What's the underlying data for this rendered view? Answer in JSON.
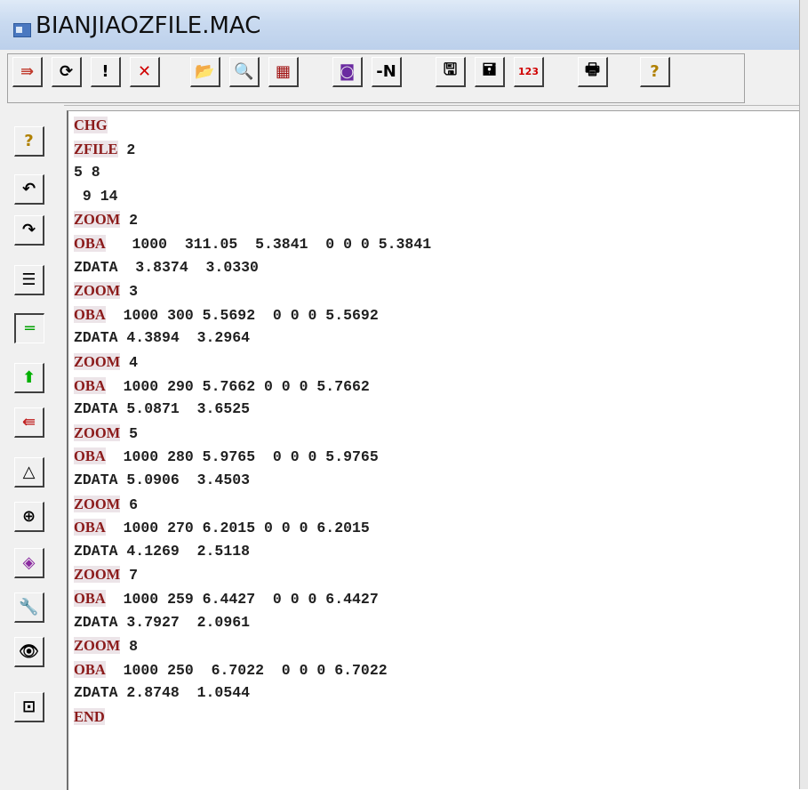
{
  "window": {
    "title": "BIANJIAOZFILE.MAC"
  },
  "toolbar": {
    "buttons": [
      {
        "name": "import-icon-button",
        "glyph": "⇛",
        "color": "#c0392b"
      },
      {
        "name": "refresh-button",
        "glyph": "⟳",
        "color": "#000000"
      },
      {
        "name": "exclaim-button",
        "glyph": "!",
        "color": "#000000"
      },
      {
        "name": "delete-button",
        "glyph": "✕",
        "color": "#d00000"
      },
      {
        "name": "open-folder-button",
        "glyph": "📂",
        "color": "#c88a00"
      },
      {
        "name": "search-button",
        "glyph": "🔍",
        "color": "#000000"
      },
      {
        "name": "macro-button",
        "glyph": "▦",
        "color": "#a01010"
      },
      {
        "name": "edit-card-button",
        "glyph": "◙",
        "color": "#6a2aa0"
      },
      {
        "name": "minus-n-button",
        "glyph": "-N",
        "color": "#000000"
      },
      {
        "name": "save-button",
        "glyph": "🖫",
        "color": "#000000"
      },
      {
        "name": "save-as-button",
        "glyph": "🖬",
        "color": "#000000"
      },
      {
        "name": "number-button",
        "glyph": "123",
        "color": "#d00000"
      },
      {
        "name": "print-button",
        "glyph": "🖶",
        "color": "#000000"
      },
      {
        "name": "help-button",
        "glyph": "?",
        "color": "#b08000"
      }
    ]
  },
  "sidebar": {
    "buttons": [
      {
        "name": "help-icon-button",
        "glyph": "?",
        "color": "#b08000"
      },
      {
        "name": "undo-button",
        "glyph": "↶",
        "color": "#000000"
      },
      {
        "name": "redo-button",
        "glyph": "↷",
        "color": "#000000"
      },
      {
        "name": "indent-button",
        "glyph": "☰",
        "color": "#000000"
      },
      {
        "name": "equal-button",
        "glyph": "═",
        "color": "#00a000"
      },
      {
        "name": "up-arrow-button",
        "glyph": "⬆",
        "color": "#00b000"
      },
      {
        "name": "left-arrow-button",
        "glyph": "⇚",
        "color": "#c02020"
      },
      {
        "name": "triangle-button",
        "glyph": "△",
        "color": "#000000"
      },
      {
        "name": "target-button",
        "glyph": "⊕",
        "color": "#000000"
      },
      {
        "name": "cube-button",
        "glyph": "◈",
        "color": "#8a2aa0"
      },
      {
        "name": "wrench-button",
        "glyph": "🔧",
        "color": "#606060"
      },
      {
        "name": "eye-button",
        "glyph": "👁",
        "color": "#000000"
      },
      {
        "name": "exit-button",
        "glyph": "⊡",
        "color": "#000000"
      }
    ]
  },
  "editor": {
    "lines": [
      {
        "kw": "CHG",
        "rest": ""
      },
      {
        "kw": "ZFILE",
        "rest": " 2"
      },
      {
        "kw": "",
        "rest": "5 8"
      },
      {
        "kw": "",
        "rest": " 9 14"
      },
      {
        "kw": "ZOOM",
        "rest": " 2"
      },
      {
        "kw": "OBA",
        "rest": "   1000  311.05  5.3841  0 0 0 5.3841"
      },
      {
        "kw": "",
        "rest": "ZDATA  3.8374  3.0330"
      },
      {
        "kw": "ZOOM",
        "rest": " 3"
      },
      {
        "kw": "OBA",
        "rest": "  1000 300 5.5692  0 0 0 5.5692"
      },
      {
        "kw": "",
        "rest": "ZDATA 4.3894  3.2964"
      },
      {
        "kw": "ZOOM",
        "rest": " 4"
      },
      {
        "kw": "OBA",
        "rest": "  1000 290 5.7662 0 0 0 5.7662"
      },
      {
        "kw": "",
        "rest": "ZDATA 5.0871  3.6525"
      },
      {
        "kw": "ZOOM",
        "rest": " 5"
      },
      {
        "kw": "OBA",
        "rest": "  1000 280 5.9765  0 0 0 5.9765"
      },
      {
        "kw": "",
        "rest": "ZDATA 5.0906  3.4503"
      },
      {
        "kw": "ZOOM",
        "rest": " 6"
      },
      {
        "kw": "OBA",
        "rest": "  1000 270 6.2015 0 0 0 6.2015"
      },
      {
        "kw": "",
        "rest": "ZDATA 4.1269  2.5118"
      },
      {
        "kw": "ZOOM",
        "rest": " 7"
      },
      {
        "kw": "OBA",
        "rest": "  1000 259 6.4427  0 0 0 6.4427"
      },
      {
        "kw": "",
        "rest": "ZDATA 3.7927  2.0961"
      },
      {
        "kw": "ZOOM",
        "rest": " 8"
      },
      {
        "kw": "OBA",
        "rest": "  1000 250  6.7022  0 0 0 6.7022"
      },
      {
        "kw": "",
        "rest": "ZDATA 2.8748  1.0544"
      },
      {
        "kw": "END",
        "rest": ""
      }
    ]
  }
}
